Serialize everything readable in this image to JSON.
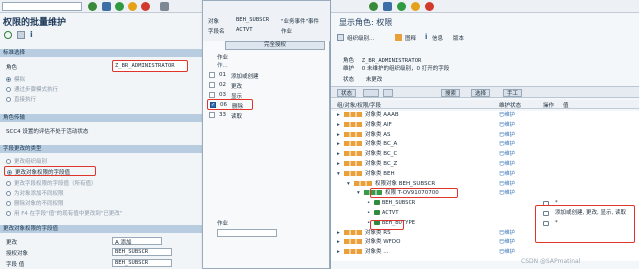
{
  "left": {
    "title": "权限的批量维护",
    "sections": {
      "target": "标准选择",
      "transport": "角色传输",
      "change_type": "字段更改的类型",
      "data": "更改对象权限的字段值"
    },
    "role_label": "角色",
    "role_value": "Z_BR_ADMINISTRATOR",
    "modes": [
      "模拟",
      "通过步骤模式执行",
      "直接执行"
    ],
    "transport_text": "SCC4 设置的评估不处于活动状态",
    "change_options": [
      "更改组织级别",
      "更改对象权限的字段值",
      "更改字段权限的字段值（所有值）",
      "为对象添加不同权限",
      "删除对象的不同权限",
      "用 F4 在字段\"值\"的现有值中更改到\"已更改\""
    ],
    "field_rows": [
      {
        "label": "更改",
        "value": "A 添加"
      },
      {
        "label": "授权对象",
        "value": "BEH_SUBSCR"
      },
      {
        "label": "字段 值",
        "value": "BEH_SUBSCR"
      }
    ]
  },
  "middle": {
    "header_labels": [
      "对象",
      "字段名"
    ],
    "object_value": "BEH_SUBSCR",
    "object_desc": "\"业务事件\"事件",
    "field_value": "ACTVT",
    "field_desc": "作业",
    "button": "完全授权",
    "list_header": "作业",
    "col_header": "作...",
    "items": [
      {
        "code": "01",
        "label": "添加或创建",
        "checked": false
      },
      {
        "code": "02",
        "label": "更改",
        "checked": false
      },
      {
        "code": "03",
        "label": "显示",
        "checked": false
      },
      {
        "code": "06",
        "label": "删除",
        "checked": true
      },
      {
        "code": "33",
        "label": "读取",
        "checked": false
      }
    ],
    "bottom_label": "作业"
  },
  "right": {
    "title": "显示角色: 权限",
    "toolbar": [
      "组织级别...",
      "图释",
      "信息",
      "版本"
    ],
    "role_label": "角色",
    "role_value": "Z_BR_ADMINISTRATOR",
    "maint_label": "维护",
    "maint_value": "0 未维护的组织级别，0 打开的字段",
    "status_label": "状态",
    "status_value": "未更改",
    "bar_buttons": [
      "状态",
      "搜索",
      "选择",
      "手工"
    ],
    "col_headers": [
      "组/对象/权限/字段",
      "维护状态",
      "操作",
      "值"
    ],
    "tree": [
      {
        "indent": 0,
        "icon": "ooo",
        "label": "对象类 AAAB",
        "status": "已维护"
      },
      {
        "indent": 0,
        "icon": "ooo",
        "label": "对象类 AIF",
        "status": "已维护"
      },
      {
        "indent": 0,
        "icon": "ooo",
        "label": "对象类 AS",
        "status": "已维护"
      },
      {
        "indent": 0,
        "icon": "ooo",
        "label": "对象类 BC_A",
        "status": "已维护"
      },
      {
        "indent": 0,
        "icon": "ooo",
        "label": "对象类 BC_C",
        "status": "已维护"
      },
      {
        "indent": 0,
        "icon": "ooo",
        "label": "对象类 BC_Z",
        "status": "已维护"
      },
      {
        "indent": 0,
        "icon": "ooo",
        "label": "对象类 BEH",
        "status": "已维护"
      },
      {
        "indent": 1,
        "icon": "ooo",
        "label": "权限对象 BEH_SUBSCR",
        "status": "已维护"
      },
      {
        "indent": 2,
        "icon": "ooo-g",
        "label": "权限 T-OV91070700",
        "status": "已维护"
      },
      {
        "indent": 3,
        "icon": "leaf",
        "label": "BEH_SUBSCR",
        "status": "",
        "value": "*"
      },
      {
        "indent": 3,
        "icon": "leaf",
        "label": "ACTVT",
        "status": "",
        "value": "添加或创建, 更改, 显示, 读取"
      },
      {
        "indent": 3,
        "icon": "leaf",
        "label": "BEH_BOTYPE",
        "status": "",
        "value": "*"
      },
      {
        "indent": 0,
        "icon": "ooo",
        "label": "对象类 RS",
        "status": "已维护"
      },
      {
        "indent": 0,
        "icon": "ooo",
        "label": "对象类 WFDO",
        "status": "已维护"
      },
      {
        "indent": 0,
        "icon": "ooo",
        "label": "对象类 ...",
        "status": "已维护"
      }
    ],
    "watermark": "CSDN @SAPmatinal"
  }
}
